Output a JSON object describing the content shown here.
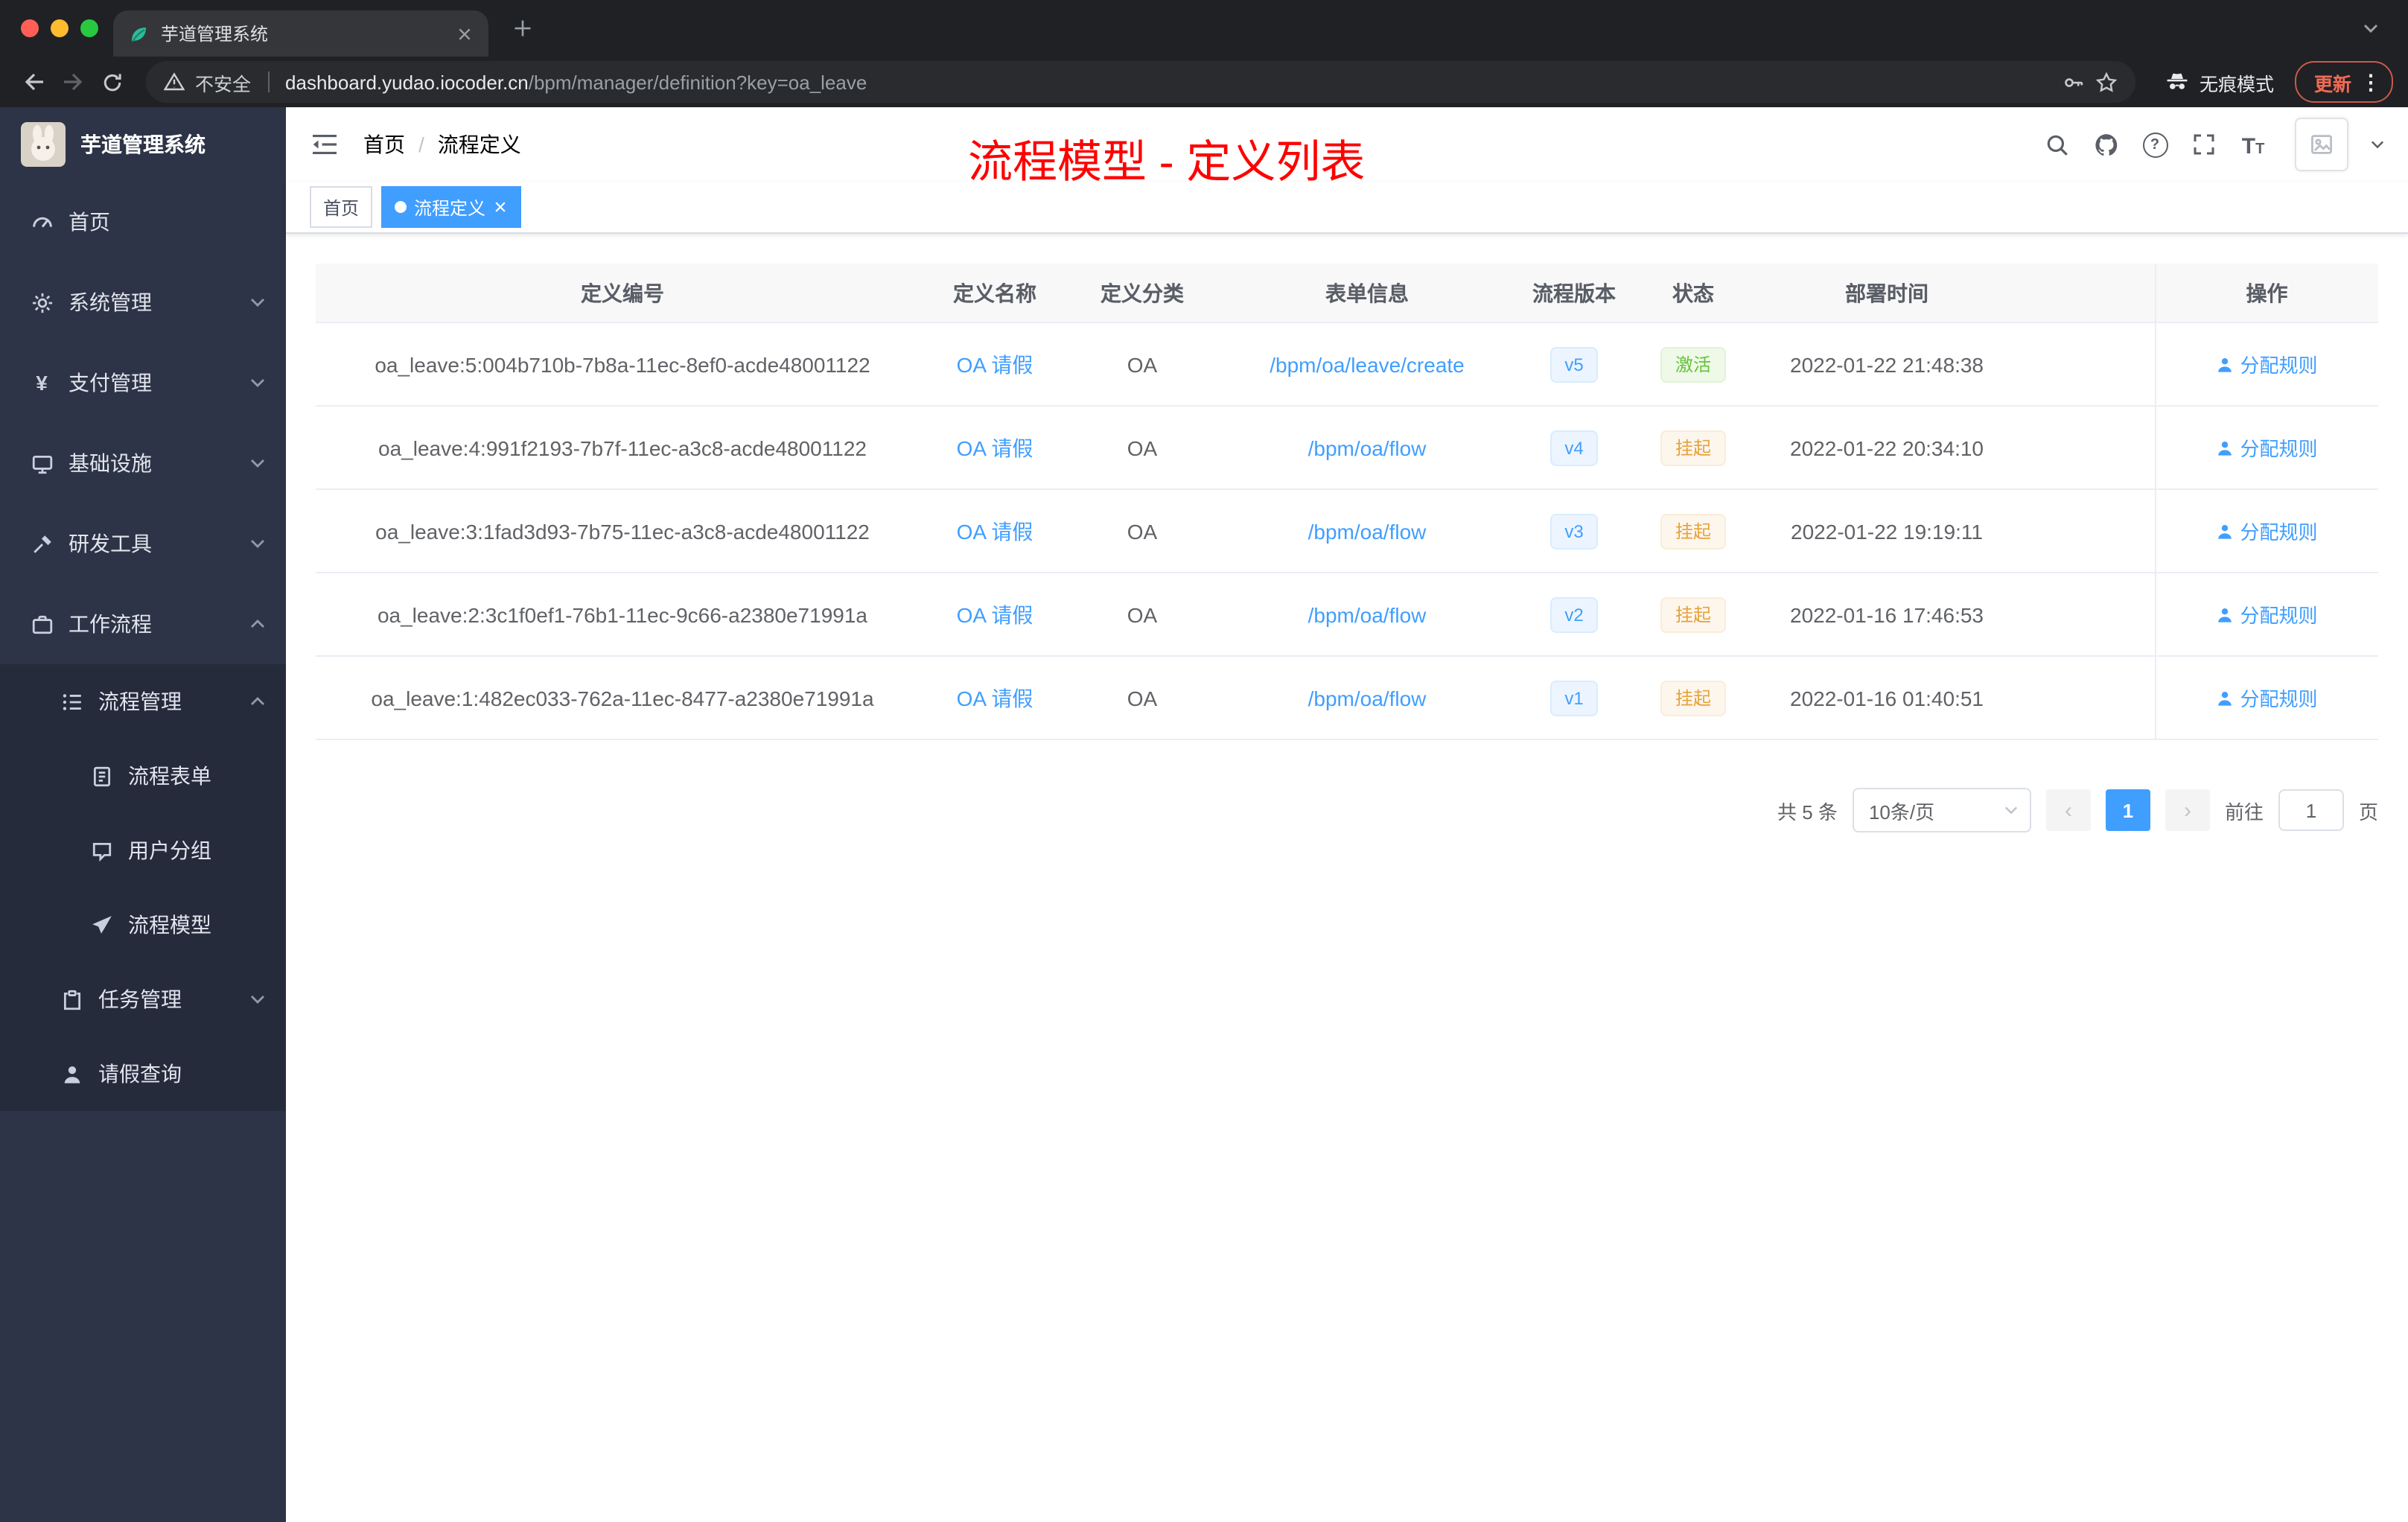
{
  "browser": {
    "tab_title": "芋道管理系统",
    "security_label": "不安全",
    "url_domain": "dashboard.yudao.iocoder.cn",
    "url_path": "/bpm/manager/definition?key=oa_leave",
    "incognito_label": "无痕模式",
    "update_label": "更新"
  },
  "icons": {
    "question_glyph": "?",
    "font_large": "T",
    "font_small": "T",
    "yen": "¥",
    "kebab": "⋮",
    "prev": "‹",
    "next": "›",
    "breadcrumb_sep": "/"
  },
  "sidebar": {
    "brand": "芋道管理系统",
    "items": [
      {
        "label": "首页",
        "icon": "dashboard-icon"
      },
      {
        "label": "系统管理",
        "icon": "gear-icon"
      },
      {
        "label": "支付管理",
        "icon": "yen-icon"
      },
      {
        "label": "基础设施",
        "icon": "monitor-icon"
      },
      {
        "label": "研发工具",
        "icon": "tools-icon"
      },
      {
        "label": "工作流程",
        "icon": "briefcase-icon"
      },
      {
        "label": "流程管理",
        "icon": "list-icon"
      },
      {
        "label": "流程表单",
        "icon": "form-icon"
      },
      {
        "label": "用户分组",
        "icon": "chat-icon"
      },
      {
        "label": "流程模型",
        "icon": "plane-icon"
      },
      {
        "label": "任务管理",
        "icon": "clipboard-icon"
      },
      {
        "label": "请假查询",
        "icon": "user-icon"
      }
    ]
  },
  "header": {
    "breadcrumb_root": "首页",
    "breadcrumb_current": "流程定义",
    "annotation": "流程模型 - 定义列表"
  },
  "tags": [
    {
      "label": "首页",
      "active": false
    },
    {
      "label": "流程定义",
      "active": true
    }
  ],
  "table": {
    "columns": [
      "定义编号",
      "定义名称",
      "定义分类",
      "表单信息",
      "流程版本",
      "状态",
      "部署时间",
      "操作"
    ],
    "action_label": "分配规则",
    "rows": [
      {
        "id": "oa_leave:5:004b710b-7b8a-11ec-8ef0-acde48001122",
        "name": "OA 请假",
        "category": "OA",
        "form": "/bpm/oa/leave/create",
        "version": "v5",
        "status": "激活",
        "time": "2022-01-22 21:48:38"
      },
      {
        "id": "oa_leave:4:991f2193-7b7f-11ec-a3c8-acde48001122",
        "name": "OA 请假",
        "category": "OA",
        "form": "/bpm/oa/flow",
        "version": "v4",
        "status": "挂起",
        "time": "2022-01-22 20:34:10"
      },
      {
        "id": "oa_leave:3:1fad3d93-7b75-11ec-a3c8-acde48001122",
        "name": "OA 请假",
        "category": "OA",
        "form": "/bpm/oa/flow",
        "version": "v3",
        "status": "挂起",
        "time": "2022-01-22 19:19:11"
      },
      {
        "id": "oa_leave:2:3c1f0ef1-76b1-11ec-9c66-a2380e71991a",
        "name": "OA 请假",
        "category": "OA",
        "form": "/bpm/oa/flow",
        "version": "v2",
        "status": "挂起",
        "time": "2022-01-16 17:46:53"
      },
      {
        "id": "oa_leave:1:482ec033-762a-11ec-8477-a2380e71991a",
        "name": "OA 请假",
        "category": "OA",
        "form": "/bpm/oa/flow",
        "version": "v1",
        "status": "挂起",
        "time": "2022-01-16 01:40:51"
      }
    ]
  },
  "pagination": {
    "total": "共 5 条",
    "page_size": "10条/页",
    "current": "1",
    "goto_prefix": "前往",
    "goto_value": "1",
    "goto_suffix": "页"
  },
  "colors": {
    "accent": "#409eff",
    "success": "#67c23a",
    "warning": "#e6a23c",
    "annotation": "#ff0000",
    "sidebar_bg": "#2e3447",
    "chrome_bg": "#202124"
  }
}
